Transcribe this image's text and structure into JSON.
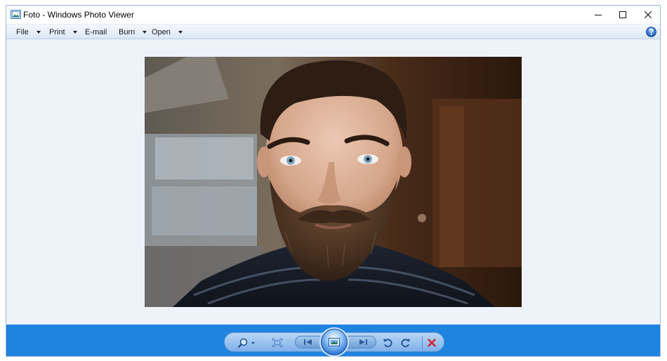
{
  "window": {
    "title": "Foto - Windows Photo Viewer"
  },
  "menu": {
    "file": "File",
    "print": "Print",
    "email": "E-mail",
    "burn": "Burn",
    "open": "Open"
  },
  "icons": {
    "app": "photo-viewer-app-icon",
    "minimize": "minimize-icon",
    "maximize": "maximize-icon",
    "close": "close-icon",
    "help": "help-icon",
    "zoom": "zoom-icon",
    "actual_size": "actual-size-icon",
    "previous": "previous-icon",
    "slideshow": "slideshow-icon",
    "next": "next-icon",
    "rotate_ccw": "rotate-counterclockwise-icon",
    "rotate_cw": "rotate-clockwise-icon",
    "delete": "delete-icon"
  },
  "colors": {
    "bottom_bar": "#1f83e0",
    "viewer_bg": "#eef3fa",
    "delete_red": "#d6262b"
  }
}
